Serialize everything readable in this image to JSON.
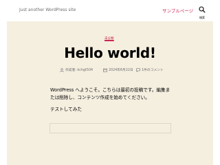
{
  "site": {
    "tagline": "Just another WordPress site",
    "nav_link": "サンプルページ",
    "search_label": "検索"
  },
  "post": {
    "category": "未分類",
    "title": "Hello world!",
    "meta": {
      "author": "作成者: kchgt504",
      "date": "2024年6月22日",
      "comments": "1件のコメント"
    },
    "content": [
      "WordPress へようこそ。こちらは最初の投稿です。編集または削除し、コンテンツ作成を始めてください。",
      "テストしてみた"
    ]
  },
  "colors": {
    "accent": "#cd2653",
    "post_background": "#f5efe0",
    "meta_text": "#6d6d6d"
  }
}
